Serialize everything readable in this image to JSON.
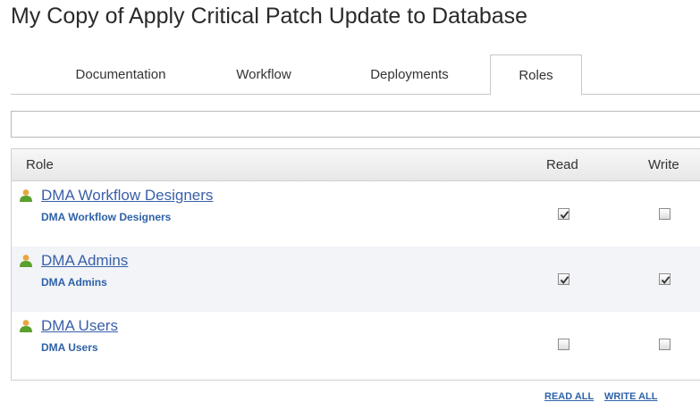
{
  "page": {
    "title": "My Copy of Apply Critical Patch Update to Database"
  },
  "tabs": [
    {
      "label": "Documentation"
    },
    {
      "label": "Workflow"
    },
    {
      "label": "Deployments"
    },
    {
      "label": "Roles",
      "active": true
    }
  ],
  "filter": {
    "value": ""
  },
  "grid": {
    "columns": {
      "role": "Role",
      "read": "Read",
      "write": "Write"
    },
    "rows": [
      {
        "name": "DMA Workflow Designers",
        "sub": "DMA Workflow Designers",
        "read": true,
        "write": false
      },
      {
        "name": "DMA Admins",
        "sub": "DMA Admins",
        "read": true,
        "write": true
      },
      {
        "name": "DMA Users",
        "sub": "DMA Users",
        "read": false,
        "write": false
      }
    ]
  },
  "actions": {
    "read_all": "READ ALL",
    "write_all": "WRITE ALL"
  },
  "icons": {
    "role": "user-group-icon",
    "check": "checkmark-icon"
  },
  "colors": {
    "link": "#3a5fa8",
    "icon_person": "#5aa02c",
    "icon_head": "#e8a640"
  }
}
